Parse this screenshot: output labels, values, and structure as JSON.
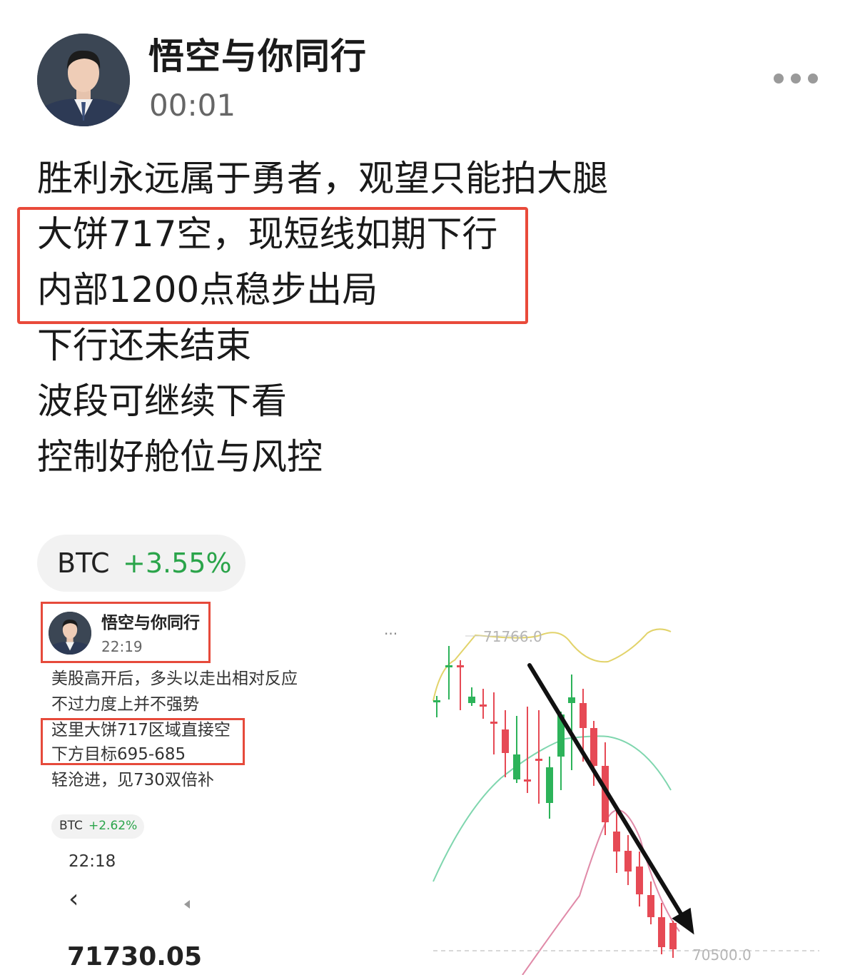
{
  "post": {
    "author": "悟空与你同行",
    "time": "00:01",
    "lines": [
      "胜利永远属于勇者，观望只能拍大腿",
      "大饼717空，现短线如期下行",
      "内部1200点稳步出局",
      "下行还未结束",
      "波段可继续下看",
      "控制好舱位与风控"
    ],
    "ticker": {
      "symbol": "BTC",
      "change": "+3.55%"
    }
  },
  "embedded": {
    "author": "悟空与你同行",
    "time": "22:19",
    "lines": [
      "美股高开后，多头以走出相对反应",
      "不过力度上并不强势",
      "这里大饼717区域直接空",
      "下方目标695-685",
      "轻沧进，见730双倍补"
    ],
    "ticker": {
      "symbol": "BTC",
      "change": "+2.62%"
    },
    "time2": "22:18",
    "back_glyph": "‹",
    "price": "71730.05",
    "more": "···"
  },
  "chart_data": {
    "type": "candlestick",
    "high_label": "71766.0",
    "low_label": "70500.0",
    "colors": {
      "up": "#2db35a",
      "down": "#e64a55",
      "band_upper": "#e2d36a",
      "band_mid": "#7fd6ae",
      "band_lower": "#e08aa8",
      "arrow": "#111111"
    }
  },
  "colors": {
    "highlight": "#e94a3a",
    "positive": "#2aa44a"
  }
}
